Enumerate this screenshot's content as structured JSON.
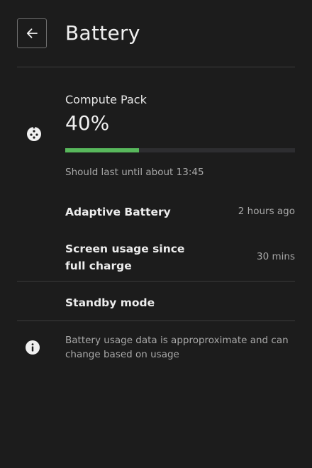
{
  "header": {
    "title": "Battery",
    "back_icon": "arrow-left-icon"
  },
  "battery": {
    "icon": "battery-status-icon",
    "pack_name": "Compute Pack",
    "percent_label": "40%",
    "level_fraction": 0.32,
    "bar_color": "#58b85c",
    "estimate": "Should last until about 13:45"
  },
  "rows": {
    "adaptive": {
      "label": "Adaptive Battery",
      "value": "2 hours ago"
    },
    "screen_usage": {
      "label": "Screen usage since full charge",
      "value": "30 mins"
    },
    "standby": {
      "label": "Standby mode"
    }
  },
  "info": {
    "icon": "info-icon",
    "text": "Battery usage data is approproximate and can change based on usage"
  }
}
